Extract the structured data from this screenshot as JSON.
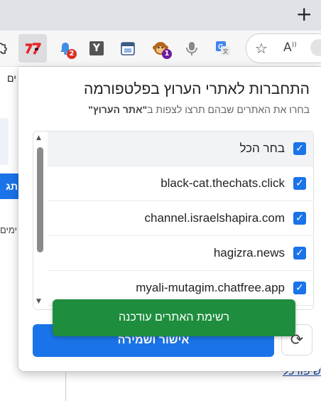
{
  "browser": {
    "new_tab_glyph": "+",
    "extensions": [
      {
        "name": "haaretz-ext",
        "badge": ""
      },
      {
        "name": "bell-ext",
        "badge": "2",
        "badge_color": "#d93025"
      },
      {
        "name": "y-ext",
        "glyph": "Y"
      },
      {
        "name": "calendar-ext"
      },
      {
        "name": "monkey-ext",
        "badge": "1",
        "badge_color": "#6a1b9a"
      },
      {
        "name": "mic-ext"
      },
      {
        "name": "translate-ext"
      }
    ]
  },
  "page": {
    "tab_text": "ים",
    "button_text": "תג",
    "side_text": "ימים",
    "link_text": "שיפורכל"
  },
  "popup": {
    "title": "התחברות לאתרי הערוץ בפלטפורמה",
    "subtitle_prefix": "בחרו את האתרים שבהם תרצו לצפות ב",
    "subtitle_bold": "\"אתר הערוץ\"",
    "select_all_label": "בחר הכל",
    "sites": [
      "black-cat.thechats.click",
      "channel.israelshapira.com",
      "hagizra.news",
      "myali-mutagim.chatfree.app"
    ],
    "save_label": "אישור ושמירה",
    "toast": "רשימת האתרים עודכנה"
  },
  "colors": {
    "accent": "#1a73e8",
    "success": "#1e8e3e"
  }
}
